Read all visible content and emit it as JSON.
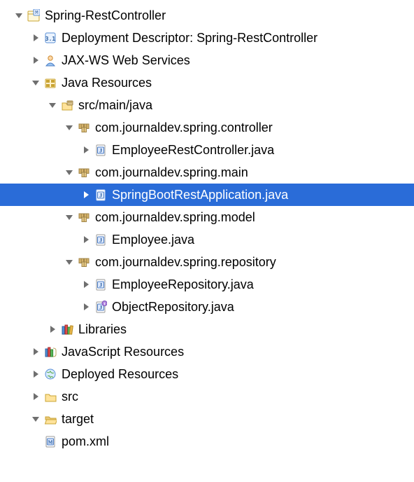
{
  "project": {
    "name": "Spring-RestController",
    "deployment_descriptor": "Deployment Descriptor: Spring-RestController",
    "jaxws": "JAX-WS Web Services",
    "java_resources": "Java Resources",
    "src_main_java": "src/main/java",
    "pkg_controller": "com.journaldev.spring.controller",
    "file_employee_rest_controller": "EmployeeRestController.java",
    "pkg_main": "com.journaldev.spring.main",
    "file_spring_boot_app": "SpringBootRestApplication.java",
    "pkg_model": "com.journaldev.spring.model",
    "file_employee": "Employee.java",
    "pkg_repository": "com.journaldev.spring.repository",
    "file_employee_repository": "EmployeeRepository.java",
    "file_object_repository": "ObjectRepository.java",
    "libraries": "Libraries",
    "js_resources": "JavaScript Resources",
    "deployed_resources": "Deployed Resources",
    "src_folder": "src",
    "target_folder": "target",
    "pom": "pom.xml"
  }
}
